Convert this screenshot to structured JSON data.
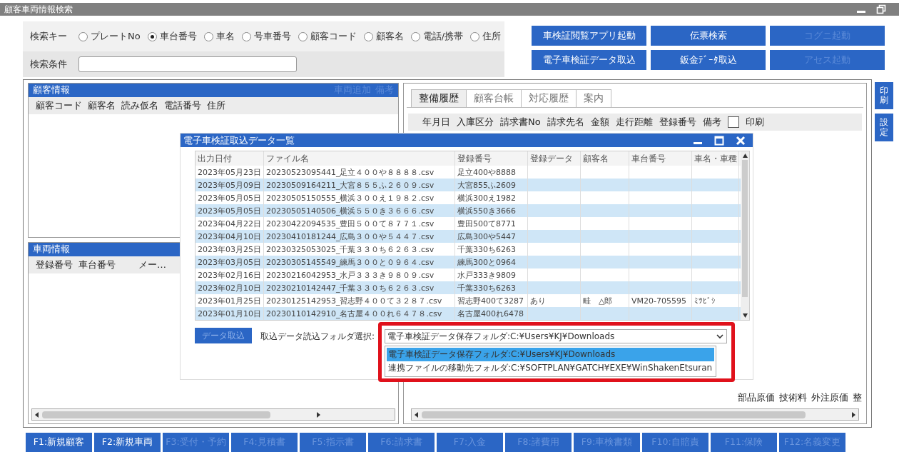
{
  "window": {
    "title": "顧客車両情報検索"
  },
  "search": {
    "key_label": "検索キー",
    "condition_label": "検索条件",
    "options": [
      {
        "label": "プレートNo",
        "selected": false
      },
      {
        "label": "車台番号",
        "selected": true
      },
      {
        "label": "車名",
        "selected": false
      },
      {
        "label": "号車番号",
        "selected": false
      },
      {
        "label": "顧客コード",
        "selected": false
      },
      {
        "label": "顧客名",
        "selected": false
      },
      {
        "label": "電話/携帯",
        "selected": false
      },
      {
        "label": "住所",
        "selected": false
      }
    ]
  },
  "action_buttons": [
    {
      "label": "車検証閲覧アプリ起動",
      "disabled": false
    },
    {
      "label": "伝票検索",
      "disabled": false
    },
    {
      "label": "コグニ起動",
      "disabled": true
    },
    {
      "label": "電子車検証データ取込",
      "disabled": false
    },
    {
      "label": "鈑金ﾃﾞｰﾀ取込",
      "disabled": false
    },
    {
      "label": "アセス起動",
      "disabled": true
    }
  ],
  "customer_panel": {
    "title": "顧客情報",
    "links": [
      {
        "label": "車両追加",
        "disabled": true
      },
      {
        "label": "備考",
        "disabled": true
      }
    ],
    "columns": [
      "顧客コード",
      "顧客名",
      "読み仮名",
      "電話番号",
      "住所"
    ]
  },
  "vehicle_panel": {
    "title": "車両情報",
    "columns": [
      "登録番号",
      "車台番号",
      "メー…"
    ]
  },
  "history_panel": {
    "tabs": [
      {
        "label": "整備履歴",
        "selected": true
      },
      {
        "label": "顧客台帳",
        "selected": false
      },
      {
        "label": "対応履歴",
        "selected": false
      },
      {
        "label": "案内",
        "selected": false
      }
    ],
    "columns": [
      "年月日",
      "入庫区分",
      "請求書No",
      "請求先名",
      "金額",
      "走行距離",
      "登録番号",
      "備考"
    ],
    "print_checkbox": {
      "label": "印刷",
      "checked": false
    },
    "columns_2": [
      "部品原価",
      "技術料",
      "外注原価",
      "整"
    ]
  },
  "side_tabs": [
    "印刷",
    "設定"
  ],
  "dialog": {
    "title": "電子車検証取込データ一覧",
    "columns": [
      "出力日付",
      "ファイル名",
      "登録番号",
      "登録データ",
      "顧客名",
      "車台番号",
      "車名・車種"
    ],
    "rows": [
      {
        "cells": [
          "2023年05月23日",
          "20230523095441_足立４００や８８８８.csv",
          "足立400や8888",
          "",
          "",
          "",
          ""
        ]
      },
      {
        "cells": [
          "2023年05月09日",
          "20230509164211_大宮８５５ふ２６０９.csv",
          "大宮855ふ2609",
          "",
          "",
          "",
          ""
        ]
      },
      {
        "cells": [
          "2023年05月05日",
          "20230505150555_横浜３００え１９８２.csv",
          "横浜300え1982",
          "",
          "",
          "",
          ""
        ]
      },
      {
        "cells": [
          "2023年05月05日",
          "20230505140506_横浜５５０き３６６６.csv",
          "横浜550き3666",
          "",
          "",
          "",
          ""
        ]
      },
      {
        "cells": [
          "2023年04月22日",
          "20230422094535_豊田５００て８７７１.csv",
          "豊田500て8771",
          "",
          "",
          "",
          ""
        ]
      },
      {
        "cells": [
          "2023年04月10日",
          "20230410181244_広島３００や５４４７.csv",
          "広島300や5447",
          "",
          "",
          "",
          ""
        ]
      },
      {
        "cells": [
          "2023年03月25日",
          "20230325053025_千葉３３０ち６２６３.csv",
          "千葉330ち6263",
          "",
          "",
          "",
          ""
        ]
      },
      {
        "cells": [
          "2023年03月05日",
          "20230305145549_練馬３００と０９６４.csv",
          "練馬300と0964",
          "",
          "",
          "",
          ""
        ]
      },
      {
        "cells": [
          "2023年02月16日",
          "20230216042953_水戸３３３き９８０９.csv",
          "水戸333き9809",
          "",
          "",
          "",
          ""
        ]
      },
      {
        "cells": [
          "2023年02月10日",
          "20230210142447_千葉３３０ち６２６３.csv",
          "千葉330ち6263",
          "",
          "",
          "",
          ""
        ]
      },
      {
        "cells": [
          "2023年01月25日",
          "20230125142953_習志野４００て３２８７.csv",
          "習志野400て3287",
          "あり",
          "畦　△郎",
          "VM20-705595",
          "ﾐﾂﾋﾞｼ"
        ]
      },
      {
        "cells": [
          "2023年01月10日",
          "20230110142910_名古屋４００れ６４７８.csv",
          "名古屋400れ6478",
          "",
          "",
          "",
          ""
        ]
      }
    ],
    "import_button": {
      "label": "データ取込",
      "disabled": true
    },
    "folder_label": "取込データ読込フォルダ選択:",
    "folder_select": {
      "value": "電子車検証データ保存フォルダ:C:¥Users¥KJ¥Downloads",
      "options": [
        {
          "label": "電子車検証データ保存フォルダ:C:¥Users¥KJ¥Downloads",
          "selected": true
        },
        {
          "label": "連携ファイルの移動先フォルダ:C:¥SOFTPLAN¥GATCH¥EXE¥WinShakenEtsuran",
          "selected": false
        }
      ]
    }
  },
  "function_keys": [
    {
      "label": "F1:新規顧客",
      "disabled": false
    },
    {
      "label": "F2:新規車両",
      "disabled": false
    },
    {
      "label": "F3:受付・予約",
      "disabled": true
    },
    {
      "label": "F4:見積書",
      "disabled": true
    },
    {
      "label": "F5:指示書",
      "disabled": true
    },
    {
      "label": "F6:請求書",
      "disabled": true
    },
    {
      "label": "F7:入金",
      "disabled": true
    },
    {
      "label": "F8:諸費用",
      "disabled": true
    },
    {
      "label": "F9:車検書類",
      "disabled": true
    },
    {
      "label": "F10:自賠責",
      "disabled": true
    },
    {
      "label": "F11:保険",
      "disabled": true
    },
    {
      "label": "F12:名義変更",
      "disabled": true
    }
  ]
}
